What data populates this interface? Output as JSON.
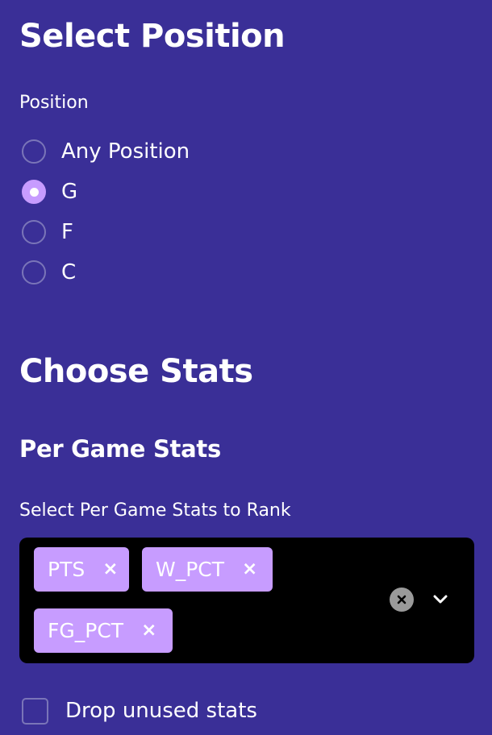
{
  "position_section": {
    "title": "Select Position",
    "radio_label": "Position",
    "options": [
      "Any Position",
      "G",
      "F",
      "C"
    ],
    "selected": "G"
  },
  "stats_section": {
    "title": "Choose Stats",
    "subtitle": "Per Game Stats",
    "multiselect_label": "Select Per Game Stats to Rank",
    "selected_tags": [
      "PTS",
      "W_PCT",
      "FG_PCT"
    ],
    "tag_remove_glyph": "×",
    "icons": {
      "clear": "clear-all-icon",
      "dropdown": "chevron-down-icon",
      "remove_tag": "close-icon"
    }
  },
  "checkbox": {
    "label": "Drop unused stats",
    "checked": false
  },
  "colors": {
    "background": "#3a2f97",
    "accent": "#c79cff",
    "input_bg": "#000000",
    "muted_border": "#7a75b8"
  }
}
